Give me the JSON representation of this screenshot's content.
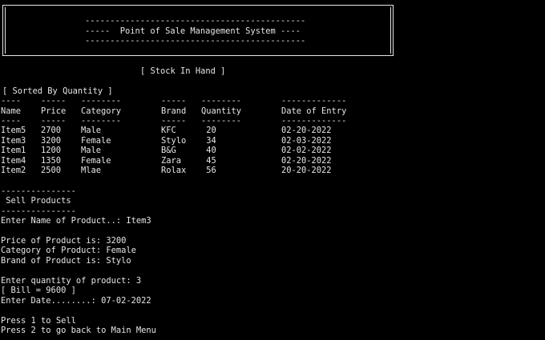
{
  "banner": {
    "rule": "--------------------------------------------",
    "title": "-----  Point of Sale Management System ----"
  },
  "stock_heading": "[ Stock In Hand ]",
  "sorted_label": "[ Sorted By Quantity ]",
  "table": {
    "top_dashes": [
      "----",
      "-----",
      "--------",
      "-----",
      "--------",
      "-------------"
    ],
    "headers": [
      "Name",
      "Price",
      "Category",
      "Brand",
      "Quantity",
      "Date of Entry"
    ],
    "under_dashes": [
      "----",
      "-----",
      "--------",
      "-----",
      "--------",
      "-------------"
    ],
    "rows": [
      [
        "Item5",
        "2700",
        "Male",
        "KFC",
        " 20",
        "02-20-2022"
      ],
      [
        "Item3",
        "3200",
        "Female",
        "Stylo",
        " 34",
        "02-03-2022"
      ],
      [
        "Item1",
        "1200",
        "Male",
        "B&G",
        " 40",
        "02-02-2022"
      ],
      [
        "Item4",
        "1350",
        "Female",
        "Zara",
        " 45",
        "02-20-2022"
      ],
      [
        "Item2",
        "2500",
        "Mlae",
        "Rolax",
        " 56",
        "20-20-2022"
      ]
    ]
  },
  "sell": {
    "dash_top": "---------------",
    "title": " Sell Products",
    "dash_bottom": "---------------",
    "enter_name": "Enter Name of Product..: Item3",
    "price": "Price of Product is: 3200",
    "category": "Category of Product: Female",
    "brand": "Brand of Product is: Stylo",
    "enter_qty": "Enter quantity of product: 3",
    "bill": "[ Bill = 9600 ]",
    "enter_date": "Enter Date........: 07-02-2022",
    "press1": "Press 1 to Sell",
    "press2": "Press 2 to go back to Main Menu"
  }
}
